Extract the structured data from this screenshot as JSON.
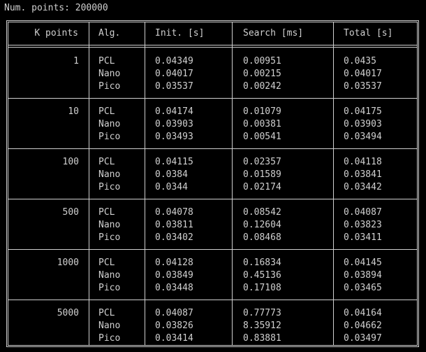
{
  "title": "Num. points: 200000",
  "headers": {
    "k_points": "K points",
    "alg": "Alg.",
    "init": "Init. [s]",
    "search": "Search [ms]",
    "total": "Total [s]"
  },
  "groups": [
    {
      "k": "1",
      "rows": [
        {
          "alg": "PCL",
          "init": "0.04349",
          "search": "0.00951",
          "total": "0.0435"
        },
        {
          "alg": "Nano",
          "init": "0.04017",
          "search": "0.00215",
          "total": "0.04017"
        },
        {
          "alg": "Pico",
          "init": "0.03537",
          "search": "0.00242",
          "total": "0.03537"
        }
      ]
    },
    {
      "k": "10",
      "rows": [
        {
          "alg": "PCL",
          "init": "0.04174",
          "search": "0.01079",
          "total": "0.04175"
        },
        {
          "alg": "Nano",
          "init": "0.03903",
          "search": "0.00381",
          "total": "0.03903"
        },
        {
          "alg": "Pico",
          "init": "0.03493",
          "search": "0.00541",
          "total": "0.03494"
        }
      ]
    },
    {
      "k": "100",
      "rows": [
        {
          "alg": "PCL",
          "init": "0.04115",
          "search": "0.02357",
          "total": "0.04118"
        },
        {
          "alg": "Nano",
          "init": "0.0384",
          "search": "0.01589",
          "total": "0.03841"
        },
        {
          "alg": "Pico",
          "init": "0.0344",
          "search": "0.02174",
          "total": "0.03442"
        }
      ]
    },
    {
      "k": "500",
      "rows": [
        {
          "alg": "PCL",
          "init": "0.04078",
          "search": "0.08542",
          "total": "0.04087"
        },
        {
          "alg": "Nano",
          "init": "0.03811",
          "search": "0.12604",
          "total": "0.03823"
        },
        {
          "alg": "Pico",
          "init": "0.03402",
          "search": "0.08468",
          "total": "0.03411"
        }
      ]
    },
    {
      "k": "1000",
      "rows": [
        {
          "alg": "PCL",
          "init": "0.04128",
          "search": "0.16834",
          "total": "0.04145"
        },
        {
          "alg": "Nano",
          "init": "0.03849",
          "search": "0.45136",
          "total": "0.03894"
        },
        {
          "alg": "Pico",
          "init": "0.03448",
          "search": "0.17108",
          "total": "0.03465"
        }
      ]
    },
    {
      "k": "5000",
      "rows": [
        {
          "alg": "PCL",
          "init": "0.04087",
          "search": "0.77773",
          "total": "0.04164"
        },
        {
          "alg": "Nano",
          "init": "0.03826",
          "search": "8.35912",
          "total": "0.04662"
        },
        {
          "alg": "Pico",
          "init": "0.03414",
          "search": "0.83881",
          "total": "0.03497"
        }
      ]
    }
  ]
}
